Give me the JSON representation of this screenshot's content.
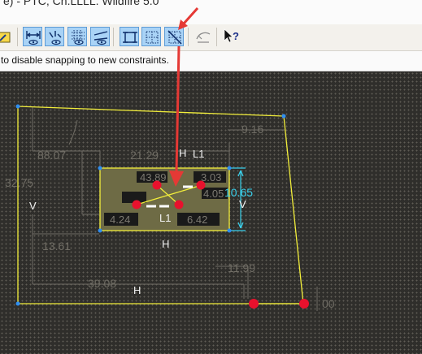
{
  "window": {
    "title": "e) - PTC, Ch.LLLL. Wildfire 5.0"
  },
  "toolbar": {
    "buttons": [
      {
        "name": "tool-sketch-button",
        "icon": "sketch-pencil-icon"
      },
      {
        "name": "horizontal-dim-button",
        "icon": "dimension-display-icon"
      },
      {
        "name": "constraint-display-button",
        "icon": "constraint-display-icon"
      },
      {
        "name": "grid-display-button",
        "icon": "grid-display-icon"
      },
      {
        "name": "vertex-display-button",
        "icon": "vertex-display-icon"
      },
      {
        "name": "ref-entity-button",
        "icon": "reference-entity-icon"
      },
      {
        "name": "grid-snap-button",
        "icon": "grid-snap-icon"
      },
      {
        "name": "disable-snapping-button",
        "icon": "disable-snapping-icon"
      },
      {
        "name": "analysis-button",
        "icon": "analysis-icon"
      },
      {
        "name": "whats-this-button",
        "icon": "whats-this-help-icon"
      }
    ]
  },
  "status": {
    "message": "to disable snapping to new constraints."
  },
  "sketch": {
    "dimensions": [
      "88.07",
      "21.29",
      "9.16",
      "32.75",
      "43.89",
      "3.03",
      "10.65",
      "4.05",
      "4.24",
      "6.42",
      "13.61",
      "11.99",
      "39.08",
      "00"
    ],
    "constraints": [
      "H",
      "L1",
      "V",
      "V",
      "L1",
      "H",
      "H"
    ]
  },
  "colors": {
    "canvas_bg": "#2f2e2b",
    "sketch_line": "#f2ee3b",
    "selected_fill": "#6e6b45",
    "dimension_text": "#6f6c64",
    "active_dimension": "#39d0ec",
    "endpoint": "#e8112d",
    "annotation_arrow": "#e53935",
    "vertex": "#2f8ef0"
  }
}
